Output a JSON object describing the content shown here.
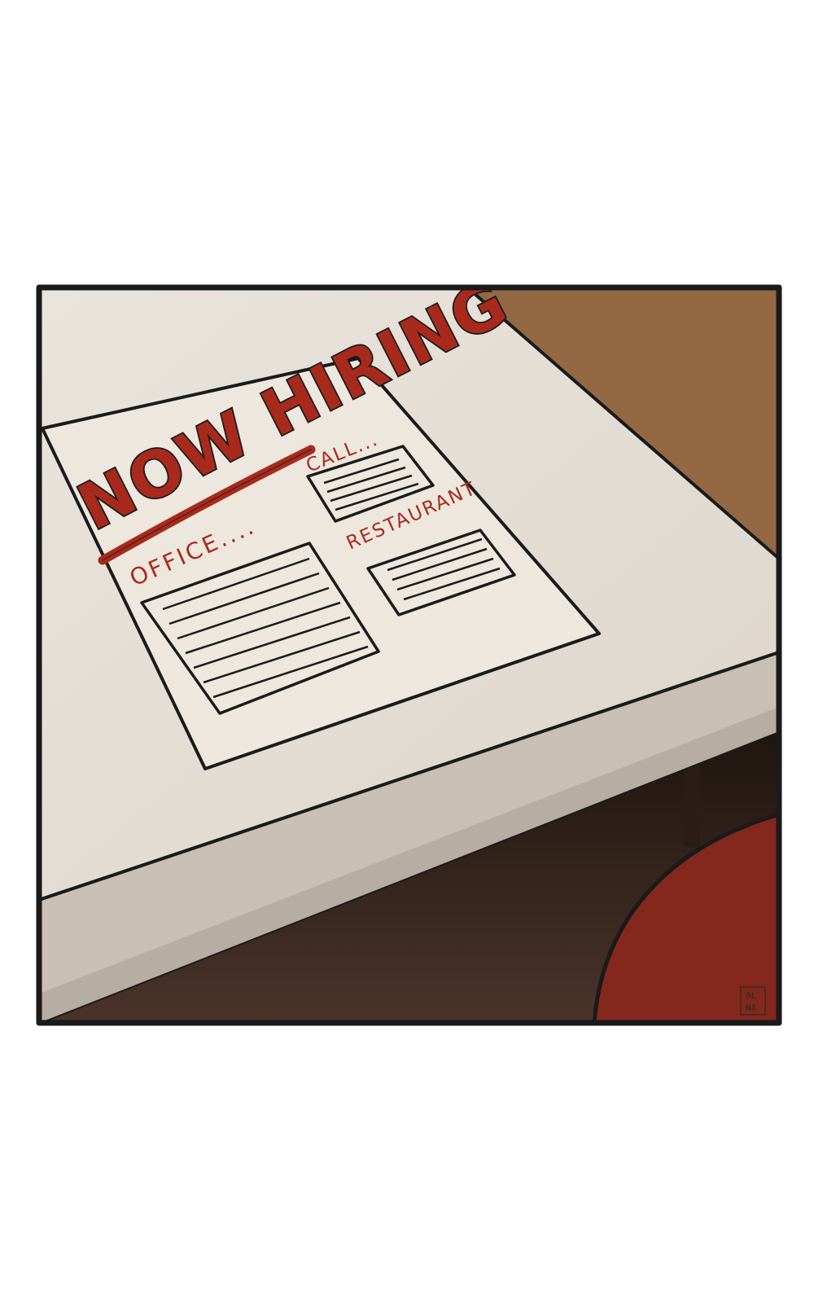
{
  "flyer": {
    "headline": "NOW HIRING",
    "section_office": "OFFICE....",
    "section_call": "CALL...",
    "section_restaurant": "RESTAURANT"
  },
  "signature": {
    "line1": "AL",
    "line2": "NA"
  },
  "colors": {
    "wall": "#956844",
    "table_top": "#e6e0d8",
    "table_edge": "#c7bdb3",
    "paper": "#eee7de",
    "ink_red": "#a82a1c",
    "chair": "#84271d",
    "floor_dark": "#2a1d15",
    "outline": "#1a1a1a"
  }
}
